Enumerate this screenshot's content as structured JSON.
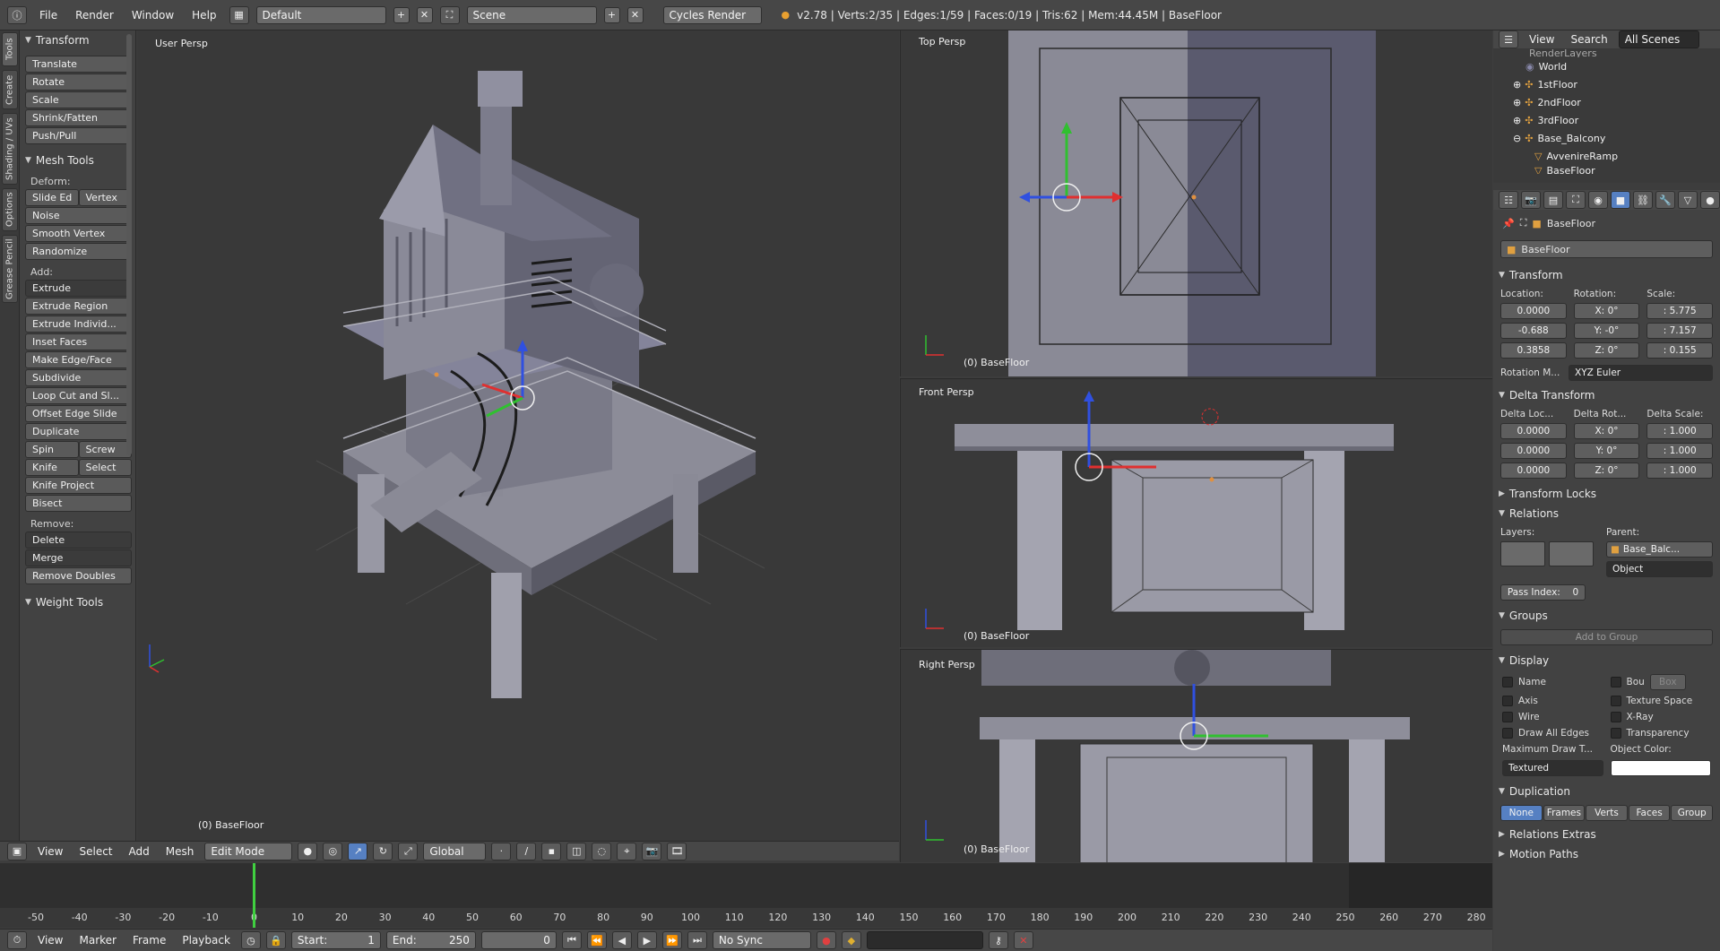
{
  "topbar": {
    "menus": [
      "File",
      "Render",
      "Window",
      "Help"
    ],
    "layout": "Default",
    "scene": "Scene",
    "engine": "Cycles Render",
    "stats": "v2.78 | Verts:2/35 | Edges:1/59 | Faces:0/19 | Tris:62 | Mem:44.45M | BaseFloor"
  },
  "tabs": [
    "Tools",
    "Create",
    "Shading / UVs",
    "Options",
    "Grease Pencil"
  ],
  "toolshelf": {
    "transform_title": "Transform",
    "transform_tools": [
      "Translate",
      "Rotate",
      "Scale",
      "Shrink/Fatten",
      "Push/Pull"
    ],
    "mesh_tools_title": "Mesh Tools",
    "deform_label": "Deform:",
    "slide_edge": "Slide Ed",
    "vertex": "Vertex",
    "deform_tools": [
      "Noise",
      "Smooth Vertex",
      "Randomize"
    ],
    "add_label": "Add:",
    "extrude": "Extrude",
    "add_tools": [
      "Extrude Region",
      "Extrude Individ...",
      "Inset Faces",
      "Make Edge/Face",
      "Subdivide",
      "Loop Cut and Sl...",
      "Offset Edge Slide",
      "Duplicate"
    ],
    "spin": "Spin",
    "screw": "Screw",
    "knife": "Knife",
    "select": "Select",
    "knife_project": "Knife Project",
    "bisect": "Bisect",
    "remove_label": "Remove:",
    "delete": "Delete",
    "merge": "Merge",
    "remove_doubles": "Remove Doubles",
    "weight_tools_title": "Weight Tools"
  },
  "viewports": {
    "main_label": "User Persp",
    "main_object": "(0) BaseFloor",
    "top_label": "Top Persp",
    "top_object": "(0) BaseFloor",
    "front_label": "Front Persp",
    "front_object": "(0) BaseFloor",
    "right_label": "Right Persp",
    "right_object": "(0) BaseFloor"
  },
  "view3d_header": {
    "menus": [
      "View",
      "Select",
      "Add",
      "Mesh"
    ],
    "mode": "Edit Mode",
    "orientation": "Global"
  },
  "timeline": {
    "ticks": [
      "-50",
      "-40",
      "-30",
      "-20",
      "-10",
      "0",
      "10",
      "20",
      "30",
      "40",
      "50",
      "60",
      "70",
      "80",
      "90",
      "100",
      "110",
      "120",
      "130",
      "140",
      "150",
      "160",
      "170",
      "180",
      "190",
      "200",
      "210",
      "220",
      "230",
      "240",
      "250",
      "260",
      "270",
      "280"
    ],
    "menus": [
      "View",
      "Marker",
      "Frame",
      "Playback"
    ],
    "start_label": "Start:",
    "start": "1",
    "end_label": "End:",
    "end": "250",
    "current": "0",
    "sync": "No Sync"
  },
  "outliner": {
    "menus": [
      "View",
      "Search"
    ],
    "filter": "All Scenes",
    "rows": [
      "RenderLayers",
      "World",
      "1stFloor",
      "2ndFloor",
      "3rdFloor",
      "Base_Balcony",
      "AvvenireRamp",
      "BaseFloor"
    ]
  },
  "properties": {
    "breadcrumb": "BaseFloor",
    "object_name": "BaseFloor",
    "transform_title": "Transform",
    "location_label": "Location:",
    "rotation_label": "Rotation:",
    "scale_label": "Scale:",
    "location": [
      "0.0000",
      "-0.688",
      "0.3858"
    ],
    "rotation": [
      {
        "axis": "X:",
        "val": "0°"
      },
      {
        "axis": "Y:",
        "val": "-0°"
      },
      {
        "axis": "Z:",
        "val": "0°"
      }
    ],
    "scale": [
      ": 5.775",
      ": 7.157",
      ": 0.155"
    ],
    "rotation_mode_label": "Rotation M...",
    "rotation_mode": "XYZ Euler",
    "delta_title": "Delta Transform",
    "delta_loc_label": "Delta Loc...",
    "delta_rot_label": "Delta Rot...",
    "delta_scale_label": "Delta Scale:",
    "delta_loc": [
      "0.0000",
      "0.0000",
      "0.0000"
    ],
    "delta_rot": [
      {
        "axis": "X:",
        "val": "0°"
      },
      {
        "axis": "Y:",
        "val": "0°"
      },
      {
        "axis": "Z:",
        "val": "0°"
      }
    ],
    "delta_scale": [
      ": 1.000",
      ": 1.000",
      ": 1.000"
    ],
    "transform_locks_title": "Transform Locks",
    "relations_title": "Relations",
    "layers_label": "Layers:",
    "parent_label": "Parent:",
    "parent": "Base_Balc...",
    "parent_type": "Object",
    "pass_index_label": "Pass Index:",
    "pass_index": "0",
    "groups_title": "Groups",
    "add_to_group": "Add to Group",
    "display_title": "Display",
    "name_label": "Name",
    "bounds_label": "Bou",
    "bounds_type": "Box",
    "axis_label": "Axis",
    "texture_space_label": "Texture Space",
    "wire_label": "Wire",
    "xray_label": "X-Ray",
    "draw_all_edges_label": "Draw All Edges",
    "transparency_label": "Transparency",
    "max_draw_label": "Maximum Draw T...",
    "max_draw": "Textured",
    "object_color_label": "Object Color:",
    "duplication_title": "Duplication",
    "dup_options": [
      "None",
      "Frames",
      "Verts",
      "Faces",
      "Group"
    ],
    "relations_extras_title": "Relations Extras",
    "motion_paths_title": "Motion Paths"
  },
  "colors": {
    "selected_blue": "#5680c2",
    "x_axis": "#e03030",
    "y_axis": "#30c030",
    "z_axis": "#3050e0",
    "frame_cursor": "#40d040"
  }
}
